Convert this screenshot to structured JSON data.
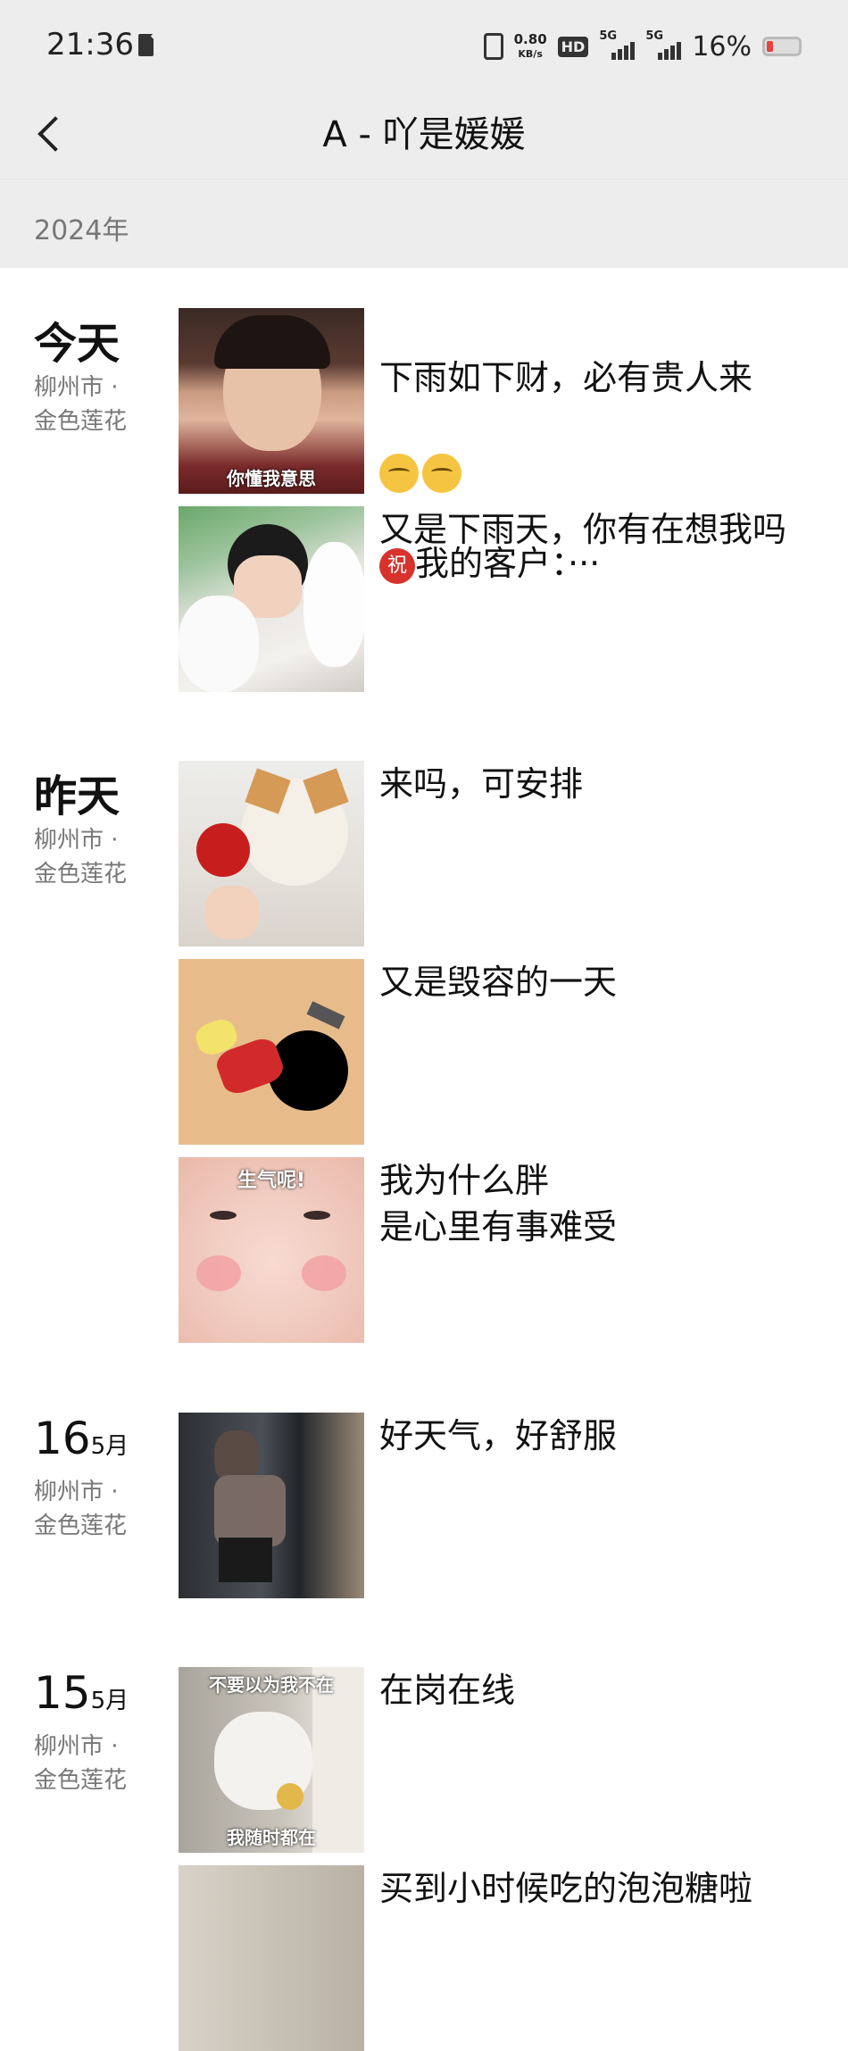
{
  "status_bar": {
    "time": "21:36",
    "net_speed_value": "0.80",
    "net_speed_unit": "KB/s",
    "hd_label": "HD",
    "sig1_label": "5G",
    "sig2_label": "5G",
    "battery_percent": "16%",
    "battery_level": 0.16
  },
  "nav": {
    "back_icon": "chevron-left",
    "title": "A - 吖是媛媛"
  },
  "year_header": "2024年",
  "days": [
    {
      "label": "今天",
      "location_line1": "柳州市 ·",
      "location_line2": "金色莲花",
      "posts": [
        {
          "image_caption": "你懂我意思",
          "text_line1": "下雨如下财，必有贵人来",
          "text_line3": "我的客户：···",
          "zhu_badge": "祝"
        },
        {
          "image_caption": "",
          "text": "又是下雨天，你有在想我吗"
        }
      ]
    },
    {
      "label": "昨天",
      "location_line1": "柳州市 ·",
      "location_line2": "金色莲花",
      "posts": [
        {
          "image_caption": "",
          "text": "来吗，可安排"
        },
        {
          "image_caption": "",
          "text": "又是毁容的一天"
        },
        {
          "image_caption": "生气呢!",
          "text": "我为什么胖\n是心里有事难受"
        }
      ]
    },
    {
      "day": "16",
      "month": "5月",
      "location_line1": "柳州市 ·",
      "location_line2": "金色莲花",
      "posts": [
        {
          "image_caption": "",
          "text": "好天气，好舒服"
        }
      ]
    },
    {
      "day": "15",
      "month": "5月",
      "location_line1": "柳州市 ·",
      "location_line2": "金色莲花",
      "posts": [
        {
          "image_caption_top": "不要以为我不在",
          "image_caption_bottom": "我随时都在",
          "text": "在岗在线"
        },
        {
          "image_caption": "",
          "text": "买到小时候吃的泡泡糖啦"
        }
      ]
    }
  ],
  "colors": {
    "header_bg": "#ededed",
    "page_bg": "#ffffff",
    "secondary_text": "#777777",
    "badge_red": "#d7322c"
  }
}
